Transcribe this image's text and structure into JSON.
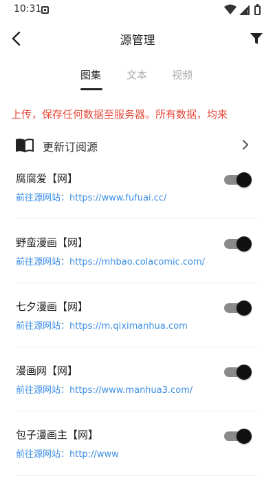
{
  "status_bar": {
    "time": "10:31"
  },
  "toolbar": {
    "title": "源管理"
  },
  "tabs": [
    {
      "label": "图集",
      "active": true
    },
    {
      "label": "文本",
      "active": false
    },
    {
      "label": "视频",
      "active": false
    }
  ],
  "marquee": {
    "text": "上传，保存任何数据至服务器。所有数据，均来",
    "color": "#e54a3c"
  },
  "update_row": {
    "label": "更新订阅源"
  },
  "sources": [
    {
      "name": "腐腐爱【网】",
      "url": "前往源网站：https://www.fufuai.cc/",
      "enabled": true
    },
    {
      "name": "野蛮漫画【网】",
      "url": "前往源网站：https://mhbao.colacomic.com/",
      "enabled": true
    },
    {
      "name": "七夕漫画【网】",
      "url": "前往源网站：https://m.qiximanhua.com",
      "enabled": true
    },
    {
      "name": "漫画网【网】",
      "url": "前往源网站：https://www.manhua3.com/",
      "enabled": true
    },
    {
      "name": "包子漫画主【网】",
      "url": "前往源网站：http://www",
      "enabled": true
    }
  ],
  "colors": {
    "link": "#3b8ee4",
    "accent_red": "#e54a3c",
    "switch_thumb": "#111111"
  }
}
